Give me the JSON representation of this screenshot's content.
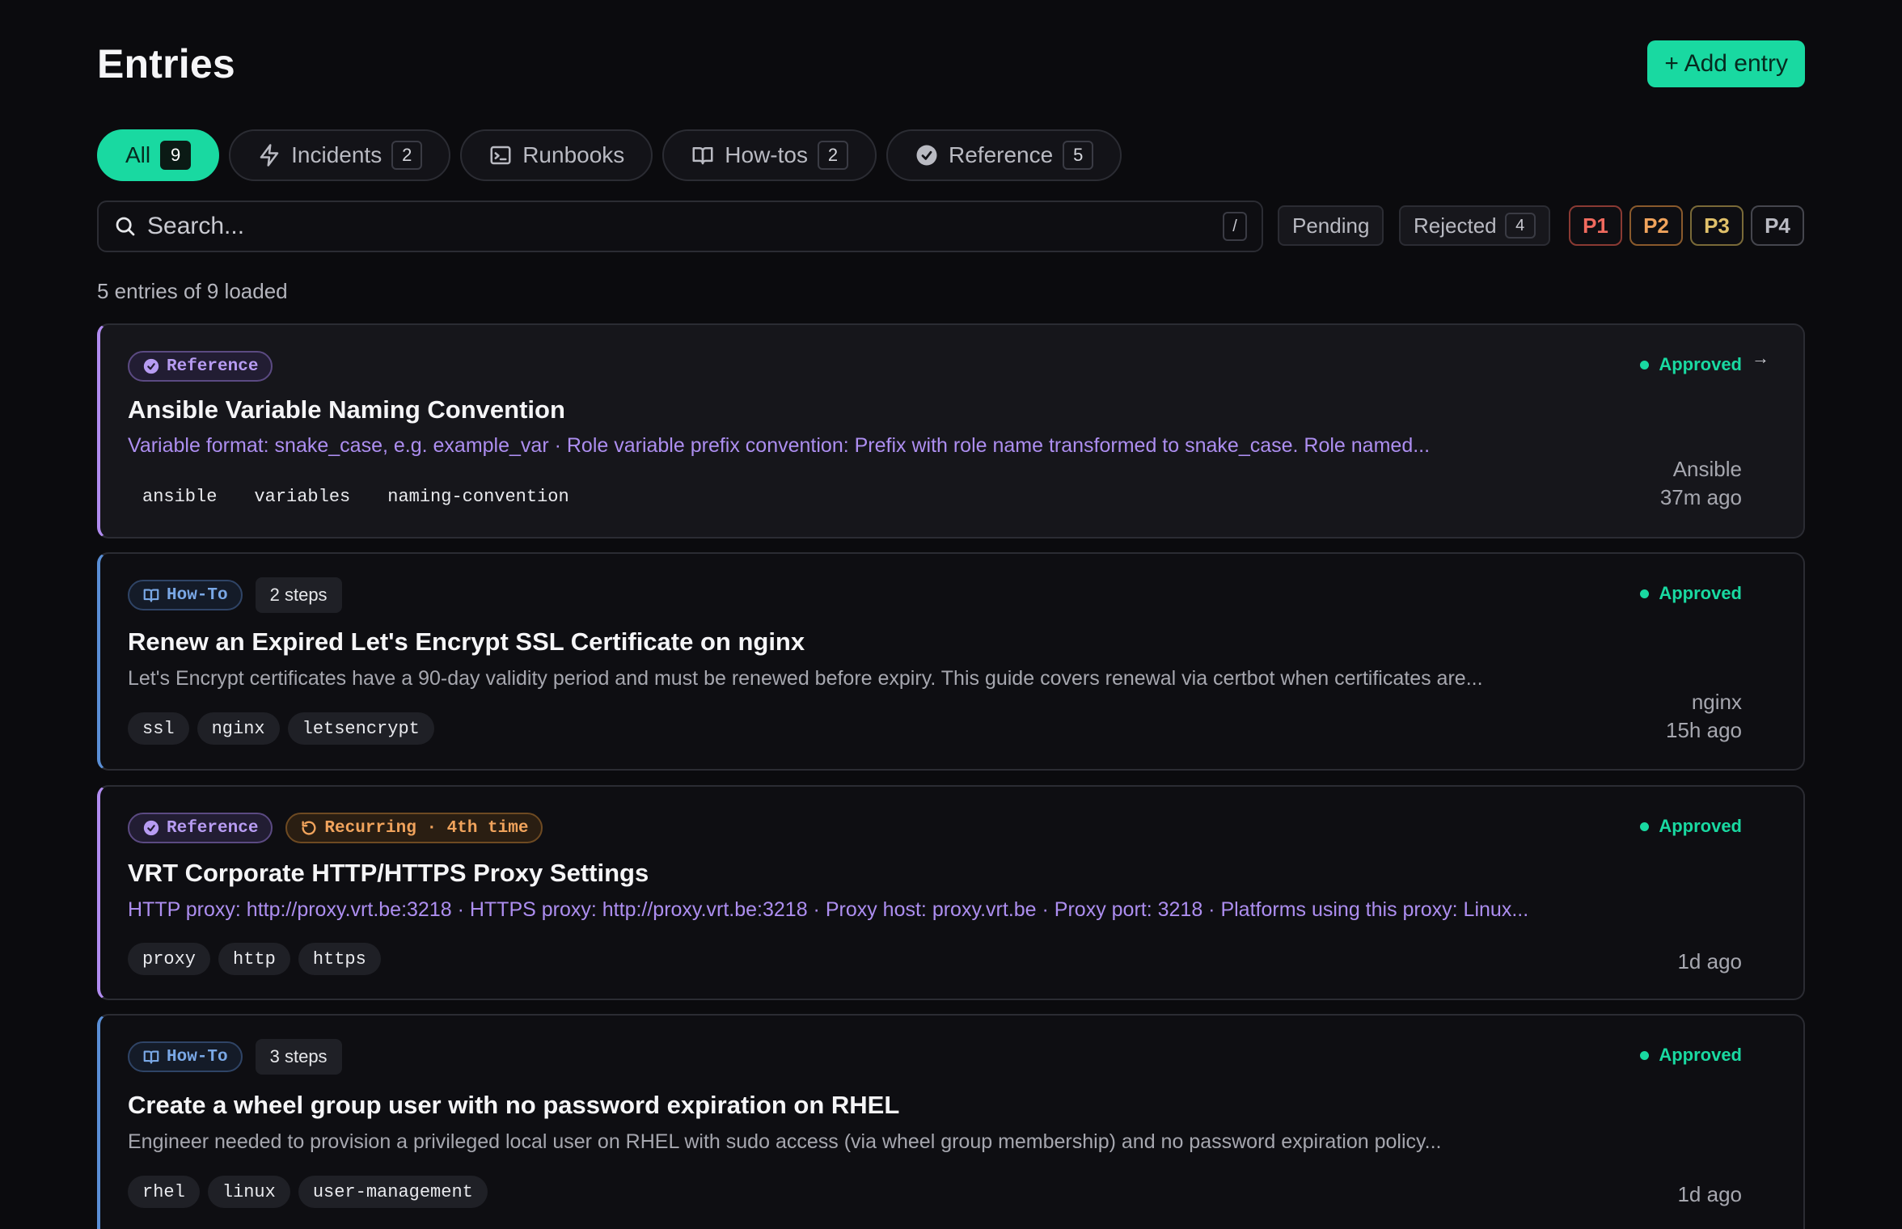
{
  "header": {
    "title": "Entries",
    "add_label": "+ Add entry"
  },
  "tabs": [
    {
      "label": "All",
      "count": "9",
      "icon": "none",
      "active": true
    },
    {
      "label": "Incidents",
      "count": "2",
      "icon": "bolt-icon"
    },
    {
      "label": "Runbooks",
      "count": "",
      "icon": "terminal-icon"
    },
    {
      "label": "How-tos",
      "count": "2",
      "icon": "book-icon"
    },
    {
      "label": "Reference",
      "count": "5",
      "icon": "check-badge-icon"
    }
  ],
  "search": {
    "placeholder": "Search...",
    "shortcut": "/"
  },
  "filters": {
    "pending": "Pending",
    "rejected": "Rejected",
    "rejected_count": "4",
    "priorities": [
      "P1",
      "P2",
      "P3",
      "P4"
    ]
  },
  "colors": {
    "accent": "#19d9a1",
    "p1": "#f06a5e",
    "p2": "#f0a35c",
    "p3": "#e0c06a",
    "p4": "#b9bac2"
  },
  "summary": "5 entries of 9 loaded",
  "entries": [
    {
      "badges": [
        "Reference"
      ],
      "title": "Ansible Variable Naming Convention",
      "desc": "Variable format: snake_case, e.g. example_var · Role variable prefix convention: Prefix with role name transformed to snake_case. Role named...",
      "tags": [
        "ansible",
        "variables",
        "naming-convention"
      ],
      "status": "Approved",
      "arrow": "→",
      "source": "Ansible",
      "time": "37m ago"
    },
    {
      "badges": [
        "How-To"
      ],
      "steps": "2 steps",
      "title": "Renew an Expired Let's Encrypt SSL Certificate on nginx",
      "desc": "Let's Encrypt certificates have a 90-day validity period and must be renewed before expiry. This guide covers renewal via certbot when certificates are...",
      "tags": [
        "ssl",
        "nginx",
        "letsencrypt"
      ],
      "status": "Approved",
      "source": "nginx",
      "time": "15h ago"
    },
    {
      "badges": [
        "Reference",
        "Recurring · 4th time"
      ],
      "title": "VRT Corporate HTTP/HTTPS Proxy Settings",
      "desc": "HTTP proxy: http://proxy.vrt.be:3218 · HTTPS proxy: http://proxy.vrt.be:3218 · Proxy host: proxy.vrt.be · Proxy port: 3218 · Platforms using this proxy: Linux...",
      "tags": [
        "proxy",
        "http",
        "https"
      ],
      "status": "Approved",
      "time": "1d ago"
    },
    {
      "badges": [
        "How-To"
      ],
      "steps": "3 steps",
      "title": "Create a wheel group user with no password expiration on RHEL",
      "desc": "Engineer needed to provision a privileged local user on RHEL with sudo access (via wheel group membership) and no password expiration policy...",
      "tags": [
        "rhel",
        "linux",
        "user-management"
      ],
      "status": "Approved",
      "time": "1d ago"
    }
  ]
}
